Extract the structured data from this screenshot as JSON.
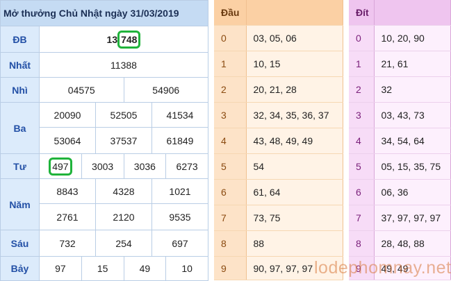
{
  "title": "Mở thưởng Chủ Nhật ngày 31/03/2019",
  "prizes": {
    "db": {
      "label": "ĐB",
      "prefix": "13",
      "suffix": "748"
    },
    "nhat": {
      "label": "Nhất",
      "values": [
        "11388"
      ]
    },
    "nhi": {
      "label": "Nhì",
      "values": [
        "04575",
        "54906"
      ]
    },
    "ba": {
      "label": "Ba",
      "values": [
        "20090",
        "52505",
        "41534",
        "53064",
        "37537",
        "61849"
      ]
    },
    "tu": {
      "label": "Tư",
      "values": [
        "497",
        "3003",
        "3036",
        "6273"
      ]
    },
    "nam": {
      "label": "Năm",
      "values": [
        "8843",
        "4328",
        "1021",
        "2761",
        "2120",
        "9535"
      ]
    },
    "sau": {
      "label": "Sáu",
      "values": [
        "732",
        "254",
        "697"
      ]
    },
    "bay": {
      "label": "Bảy",
      "values": [
        "97",
        "15",
        "49",
        "10"
      ]
    }
  },
  "dau": {
    "header": "Đầu",
    "rows": [
      {
        "k": "0",
        "v": "03, 05, 06"
      },
      {
        "k": "1",
        "v": "10, 15"
      },
      {
        "k": "2",
        "v": "20, 21, 28"
      },
      {
        "k": "3",
        "v": "32, 34, 35, 36, 37"
      },
      {
        "k": "4",
        "v": "43, 48, 49, 49"
      },
      {
        "k": "5",
        "v": "54"
      },
      {
        "k": "6",
        "v": "61, 64"
      },
      {
        "k": "7",
        "v": "73, 75"
      },
      {
        "k": "8",
        "v": "88"
      },
      {
        "k": "9",
        "v": "90, 97, 97, 97"
      }
    ]
  },
  "dit": {
    "header": "Đít",
    "rows": [
      {
        "k": "0",
        "v": "10, 20, 90"
      },
      {
        "k": "1",
        "v": "21, 61"
      },
      {
        "k": "2",
        "v": "32"
      },
      {
        "k": "3",
        "v": "03, 43, 73"
      },
      {
        "k": "4",
        "v": "34, 54, 64"
      },
      {
        "k": "5",
        "v": "05, 15, 35, 75"
      },
      {
        "k": "6",
        "v": "06, 36"
      },
      {
        "k": "7",
        "v": "37, 97, 97, 97"
      },
      {
        "k": "8",
        "v": "28, 48, 88"
      },
      {
        "k": "9",
        "v": "49, 49"
      }
    ]
  },
  "watermark": "lodephomnay.net",
  "highlight_color": "#1fb33b"
}
